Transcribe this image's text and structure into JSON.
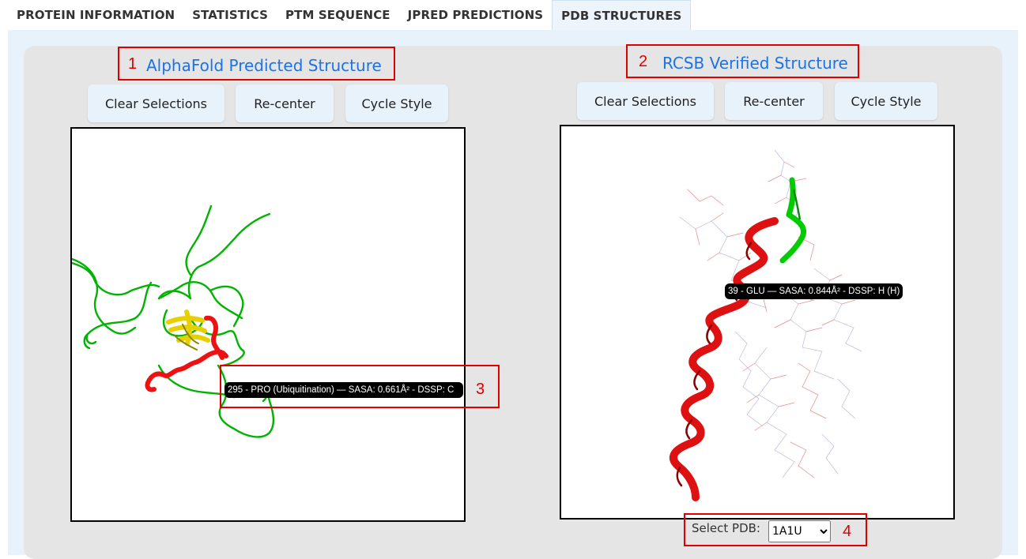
{
  "tabs": [
    {
      "label": "PROTEIN INFORMATION"
    },
    {
      "label": "STATISTICS"
    },
    {
      "label": "PTM SEQUENCE"
    },
    {
      "label": "JPRED PREDICTIONS"
    },
    {
      "label": "PDB STRUCTURES"
    }
  ],
  "active_tab": "PDB STRUCTURES",
  "left": {
    "title": "AlphaFold Predicted Structure",
    "buttons": {
      "clear": "Clear Selections",
      "recenter": "Re-center",
      "cycle": "Cycle Style"
    },
    "tooltip": "295 - PRO (Ubiquitination) — SASA: 0.661Å² - DSSP: C"
  },
  "right": {
    "title": "RCSB Verified Structure",
    "buttons": {
      "clear": "Clear Selections",
      "recenter": "Re-center",
      "cycle": "Cycle Style"
    },
    "tooltip": "39 - GLU — SASA: 0.844Å² - DSSP: H (H)",
    "select_label": "Select PDB:",
    "select_value": "1A1U"
  },
  "annotations": [
    "1",
    "2",
    "3",
    "4"
  ],
  "colors": {
    "title": "#1a73e8",
    "annotation": "#e00000",
    "coil": "#00b300",
    "helix": "#ee1111",
    "sheet": "#e8d000"
  }
}
